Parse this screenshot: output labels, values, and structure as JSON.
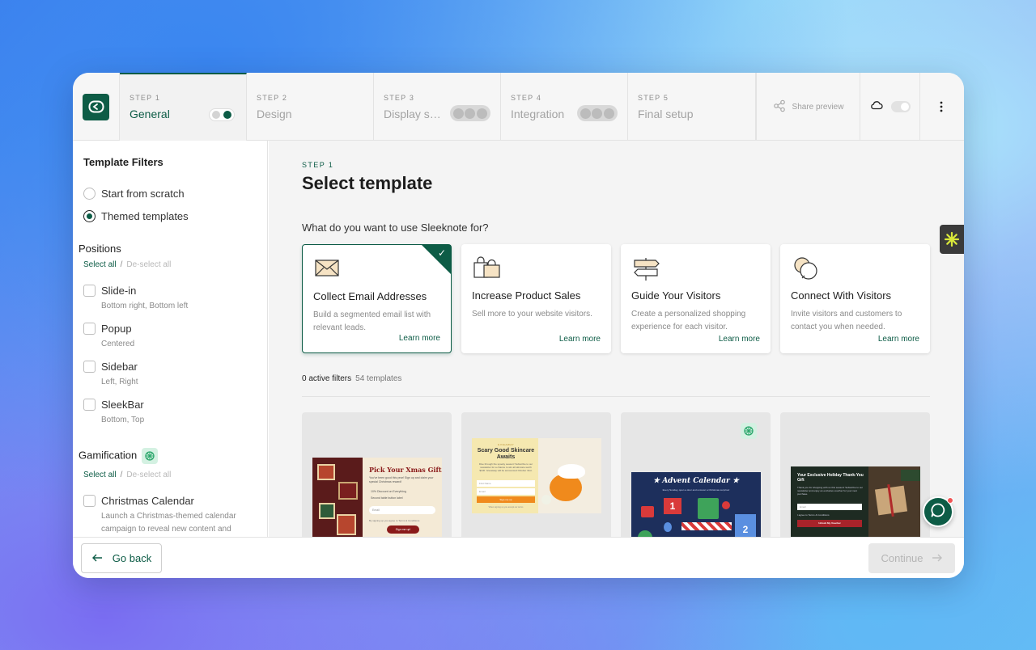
{
  "topbar": {
    "steps": [
      {
        "num": "STEP 1",
        "name": "General"
      },
      {
        "num": "STEP 2",
        "name": "Design"
      },
      {
        "num": "STEP 3",
        "name": "Display se..."
      },
      {
        "num": "STEP 4",
        "name": "Integration"
      },
      {
        "num": "STEP 5",
        "name": "Final setup"
      }
    ],
    "share_label": "Share preview"
  },
  "sidebar": {
    "title": "Template Filters",
    "radio": [
      "Start from scratch",
      "Themed templates"
    ],
    "positions_title": "Positions",
    "select_all": "Select all",
    "deselect_all": "De-select all",
    "positions": [
      {
        "label": "Slide-in",
        "sub": "Bottom right, Bottom left"
      },
      {
        "label": "Popup",
        "sub": "Centered"
      },
      {
        "label": "Sidebar",
        "sub": "Left, Right"
      },
      {
        "label": "SleekBar",
        "sub": "Bottom, Top"
      }
    ],
    "gamification_title": "Gamification",
    "gamification": [
      {
        "label": "Christmas Calendar",
        "sub": "Launch a Christmas-themed calendar campaign to reveal new content and"
      }
    ]
  },
  "main": {
    "step": "STEP 1",
    "title": "Select template",
    "question": "What do you want to use Sleeknote for?",
    "cards": [
      {
        "title": "Collect Email Addresses",
        "desc": "Build a segmented email list with relevant leads.",
        "link": "Learn more"
      },
      {
        "title": "Increase Product Sales",
        "desc": "Sell more to your website visitors.",
        "link": "Learn more"
      },
      {
        "title": "Guide Your Visitors",
        "desc": "Create a personalized shopping experience for each visitor.",
        "link": "Learn more"
      },
      {
        "title": "Connect With Visitors",
        "desc": "Invite visitors and customers to contact you when needed.",
        "link": "Learn more"
      }
    ],
    "filters_count": "0 active filters",
    "templates_count": "54 templates",
    "templates": [
      {
        "title": "Pick Your Xmas Gift",
        "body": "You've been good this year! Sign up and claim your special Christmas reward!",
        "opt1": "10% Discount on Everything",
        "opt2": "Second table button label",
        "field": "Email",
        "consent": "By signing up you agree to Terms & Conditions",
        "cta": "Sign me up!"
      },
      {
        "kicker": "GIVEAWAY",
        "title": "Scary Good Skincare Awaits",
        "body": "Dive through the spooky season! Subscribe to our newsletter for a chance to win all skincare worth $100. Giveaway will be announced October 31st.",
        "field1": "First Name",
        "field2": "Email",
        "cta": "Sign me up",
        "consent": "When signing up you accept our terms"
      },
      {
        "title": "Advent Calendar",
        "body": "Every Sunday, open a door and uncover a Christmas surprise!",
        "n1": "1",
        "n2": "2"
      },
      {
        "title": "Your Exclusive Holiday Thank-You Gift",
        "body": "Thank you for shopping with us this season! Subscribe to our newsletter and enjoy an exclusive voucher for your next purchase.",
        "field": "Email",
        "consent": "I agree to Terms & Conditions",
        "cta": "Unlock My Voucher"
      }
    ]
  },
  "footer": {
    "back": "Go back",
    "continue": "Continue"
  },
  "colors": {
    "brand": "#0d5c46",
    "accent_red": "#f05656"
  }
}
